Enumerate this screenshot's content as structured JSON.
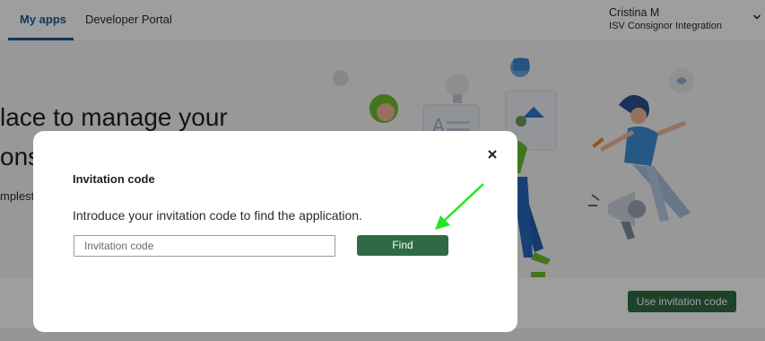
{
  "nav": {
    "tabs": [
      {
        "label": "My apps",
        "active": true
      },
      {
        "label": "Developer Portal",
        "active": false
      }
    ],
    "user": {
      "name": "Cristina M",
      "organization": "ISV Consignor Integration"
    }
  },
  "hero": {
    "title_line1": "lace to manage your",
    "title_line2": "ons",
    "subtitle": "mplest"
  },
  "actions": {
    "use_invitation_code_label": "Use invitation code"
  },
  "modal": {
    "title": "Invitation code",
    "description": "Introduce your invitation code to find the application.",
    "input": {
      "placeholder": "Invitation code",
      "value": ""
    },
    "find_label": "Find",
    "close_icon": "close-icon"
  },
  "annotation": {
    "icon": "arrow-icon",
    "color": "#22e622"
  },
  "colors": {
    "accent_blue": "#1b5a8f",
    "button_green": "#2e6b44",
    "overlay": "rgba(0,0,0,0.38)"
  }
}
